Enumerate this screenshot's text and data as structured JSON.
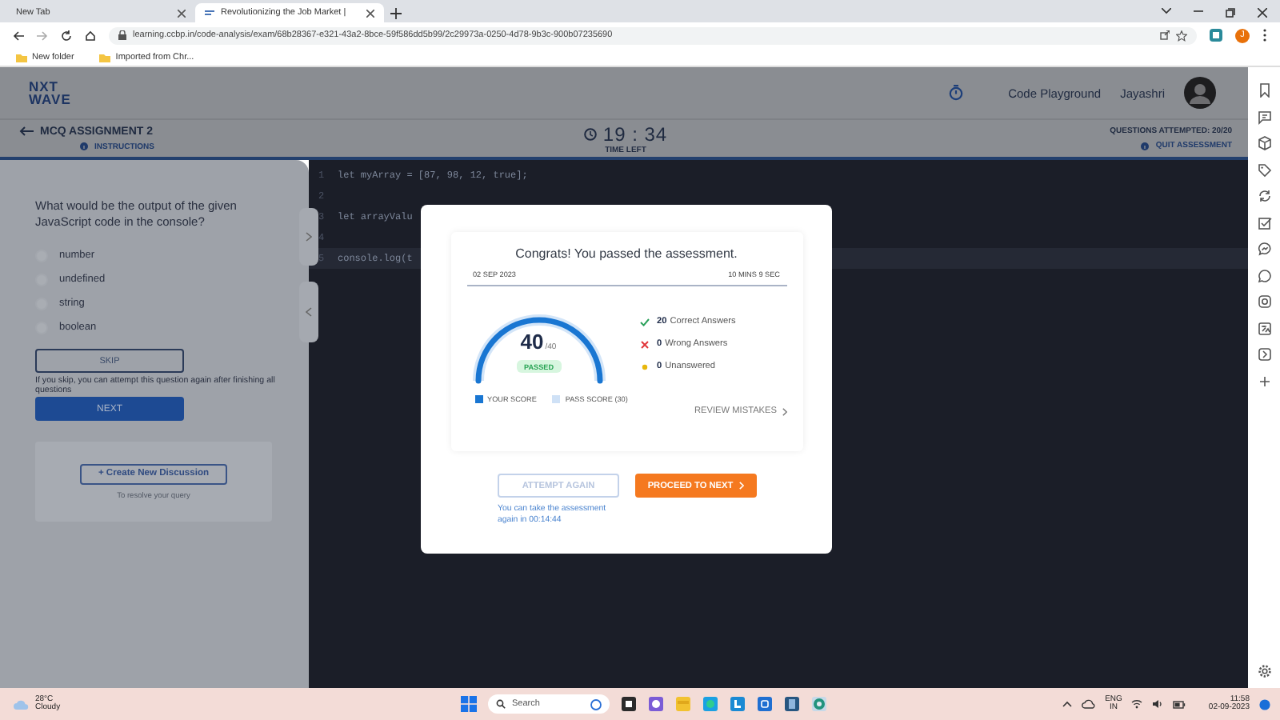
{
  "browser": {
    "tabs": [
      {
        "title": "New Tab",
        "selected": false
      },
      {
        "title": "Revolutionizing the Job Market |",
        "selected": true
      }
    ],
    "url": "learning.ccbp.in/code-analysis/exam/68b28367-e321-43a2-8bce-59f586dd5b99/2c29973a-0250-4d78-9b3c-900b07235690",
    "profile_initial": "J",
    "bookmarks": [
      "New folder",
      "Imported from Chr..."
    ]
  },
  "header": {
    "logo_top": "NXT",
    "logo_bottom": "WAVE",
    "playground": "Code Playground",
    "user": "Jayashri"
  },
  "exam_bar": {
    "title": "MCQ ASSIGNMENT 2",
    "instructions": "INSTRUCTIONS",
    "timer": "19 : 34",
    "timer_label": "TIME LEFT",
    "attempted": "QUESTIONS ATTEMPTED: 20/20",
    "quit": "QUIT ASSESSMENT"
  },
  "question": {
    "text": "What would be the output of the given JavaScript code in the console?",
    "options": [
      {
        "label": "number",
        "selected": false
      },
      {
        "label": "undefined",
        "selected": false
      },
      {
        "label": "string",
        "selected": false
      },
      {
        "label": "boolean",
        "selected": false
      }
    ],
    "skip": "SKIP",
    "skip_note": "If you skip, you can attempt this question again after finishing all questions",
    "next": "NEXT",
    "discussion_button": "+ Create New Discussion",
    "discussion_note": "To resolve your query"
  },
  "editor": {
    "lines": [
      {
        "number": "1",
        "code": "let myArray = [87, 98, 12, true];",
        "selected": false
      },
      {
        "number": "2",
        "selected": false
      },
      {
        "number": "3",
        "code": "let arrayValu",
        "selected": false
      },
      {
        "number": "4",
        "selected": false
      },
      {
        "number": "5",
        "code": "console.log(t",
        "selected": true
      }
    ]
  },
  "modal": {
    "title": "Congrats! You passed the assessment.",
    "date": "02 SEP 2023",
    "duration": "10 MINS 9 SEC",
    "score": "40",
    "total": "/40",
    "status": "PASSED",
    "level": 1,
    "stats": [
      {
        "kind": "correct",
        "count": "20",
        "label": "Correct Answers"
      },
      {
        "kind": "wrong",
        "count": "0",
        "label": "Wrong Answers"
      },
      {
        "kind": "unanswered",
        "count": "0",
        "label": "Unanswered"
      }
    ],
    "legend": [
      "YOUR SCORE",
      "PASS SCORE (30)"
    ],
    "review": "REVIEW MISTAKES",
    "attempt_again": {
      "label": "ATTEMPT AGAIN",
      "disabled": true
    },
    "proceed": "PROCEED TO NEXT",
    "retake_note": "You can take the assessment again in 00:14:44"
  },
  "taskbar": {
    "temperature": "28°C",
    "weather": "Cloudy",
    "search_placeholder": "Search",
    "language": "ENG",
    "region": "IN",
    "time": "11:58",
    "date": "02-09-2023"
  }
}
